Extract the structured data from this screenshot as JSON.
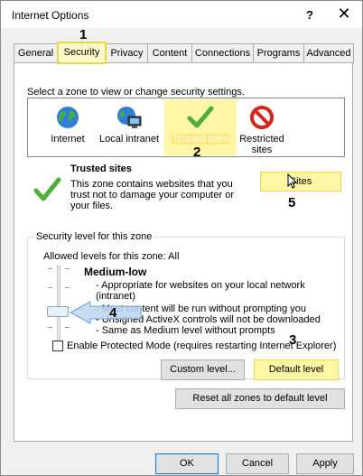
{
  "window": {
    "title": "Internet Options",
    "help_label": "?",
    "close_label": "✕"
  },
  "tabs": [
    {
      "label": "General"
    },
    {
      "label": "Security"
    },
    {
      "label": "Privacy"
    },
    {
      "label": "Content"
    },
    {
      "label": "Connections"
    },
    {
      "label": "Programs"
    },
    {
      "label": "Advanced"
    }
  ],
  "zones_prompt": "Select a zone to view or change security settings.",
  "zones": [
    {
      "label": "Internet",
      "icon": "globe-icon"
    },
    {
      "label": "Local intranet",
      "icon": "local-intranet-icon"
    },
    {
      "label": "Trusted sites",
      "icon": "checkmark-icon",
      "selected": true
    },
    {
      "label": "Restricted sites",
      "icon": "restricted-icon"
    }
  ],
  "zone_info": {
    "heading": "Trusted sites",
    "description": "This zone contains websites that you trust not to damage your computer or your files.",
    "sites_button": "Sites"
  },
  "security_level": {
    "group_title": "Security level for this zone",
    "allowed_label": "Allowed levels for this zone: All",
    "level_name": "Medium-low",
    "bullets": [
      "- Appropriate for websites on your local network (intranet)",
      "- Most content will be run without prompting you",
      "- Unsigned ActiveX controls will not be downloaded",
      "- Same as Medium level without prompts"
    ],
    "protected_mode_label": "Enable Protected Mode (requires restarting Internet Explorer)",
    "protected_mode_checked": false,
    "custom_level_button": "Custom level...",
    "default_level_button": "Default level",
    "reset_all_button": "Reset all zones to default level"
  },
  "footer": {
    "ok": "OK",
    "cancel": "Cancel",
    "apply": "Apply"
  },
  "annotations": [
    "1",
    "2",
    "3",
    "4",
    "5"
  ],
  "colors": {
    "highlight": "#fff6a6",
    "highlight_border": "#e6d84a",
    "callout_arrow": "#bcd6f0"
  }
}
